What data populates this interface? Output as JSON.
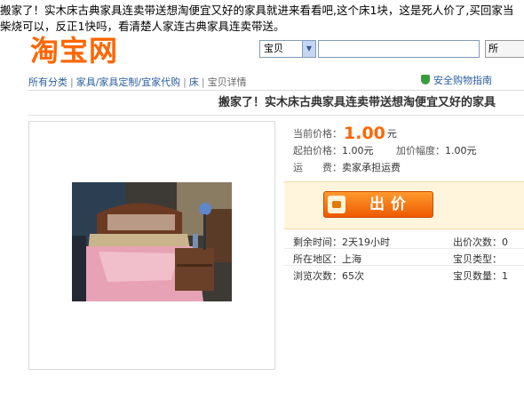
{
  "caption": "搬家了！实木床古典家具连卖带送想淘便宜又好的家具就进来看看吧,这个床1块，这是死人价了,买回家当柴烧可以，反正1快吗，看清楚人家连古典家具连卖带送。",
  "logo": "淘宝网",
  "search": {
    "select_value": "宝贝",
    "input_value": "",
    "button_label": "所"
  },
  "secure_label": "安全购物指南",
  "breadcrumb": [
    "所有分类",
    "家具/家具定制/宜家代购",
    "床",
    "宝贝详情"
  ],
  "item_title": "搬家了！实木床古典家具连卖带送想淘便宜又好的家具",
  "price": {
    "label": "当前价格：",
    "value": "1.00",
    "unit": "元"
  },
  "start_price": {
    "label": "起拍价格：",
    "value": "1.00元"
  },
  "increment": {
    "label": "加价幅度：",
    "value": "1.00元"
  },
  "shipping": {
    "label": "运　　费：",
    "value": "卖家承担运费"
  },
  "bid_button_label": "出价",
  "stats": {
    "time_left": {
      "label": "剩余时间：",
      "value": "2天19小时"
    },
    "location": {
      "label": "所在地区：",
      "value": "上海"
    },
    "views": {
      "label": "浏览次数：",
      "value": "65次"
    },
    "bids": {
      "label": "出价次数：",
      "value": "0"
    },
    "item_type": {
      "label": "宝贝类型：",
      "value": ""
    },
    "quantity": {
      "label": "宝贝数量：",
      "value": "1"
    }
  },
  "colors": {
    "brand": "#ff6600",
    "link": "#2b5f9e",
    "bid_panel": "#fff5dc"
  }
}
